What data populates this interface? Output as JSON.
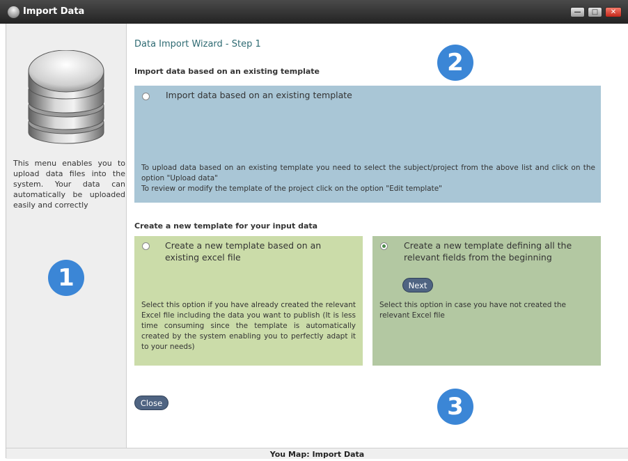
{
  "window": {
    "title": "Import Data",
    "controls": {
      "minimize": "—",
      "maximize": "□",
      "close": "✕"
    }
  },
  "sidebar": {
    "icon": "database-icon",
    "description": "This menu enables you to upload data files into the system. Your data can automatically be uploaded easily and correctly",
    "marker": "1"
  },
  "main": {
    "wizard_title": "Data Import Wizard - Step 1",
    "marker_top": "2",
    "marker_bottom": "3",
    "existing_section": {
      "heading": "Import data based on an existing template",
      "option_label": "Import data based on an existing template",
      "option_selected": false,
      "description_line1": "To upload data based on an existing template you need to select the subject/project from the above list and click on the option \"Upload data\"",
      "description_line2": "To review or modify the template of the project click on the option \"Edit template\""
    },
    "new_section": {
      "heading": "Create a new template for your input data",
      "from_excel": {
        "option_label": "Create a new template based on an existing excel file",
        "selected": false,
        "description": "Select this option if you have already created the relevant Excel file including the data you want to publish (It is less time consuming since the template is automatically created by the system enabling you to perfectly adapt it to your needs)"
      },
      "from_scratch": {
        "option_label": "Create a new template defining all the relevant fields from the beginning",
        "selected": true,
        "next_label": "Next",
        "description": "Select this option in case you have not created the relevant Excel file"
      }
    },
    "close_label": "Close"
  },
  "statusbar": {
    "text": "You Map: Import Data"
  },
  "colors": {
    "marker_blue": "#3b86d6",
    "panel_blue": "#a9c6d6",
    "panel_light_green": "#cbdca9",
    "panel_dark_green": "#b3c8a2",
    "pill_button": "#4f6482",
    "title_teal": "#2e6a72"
  }
}
